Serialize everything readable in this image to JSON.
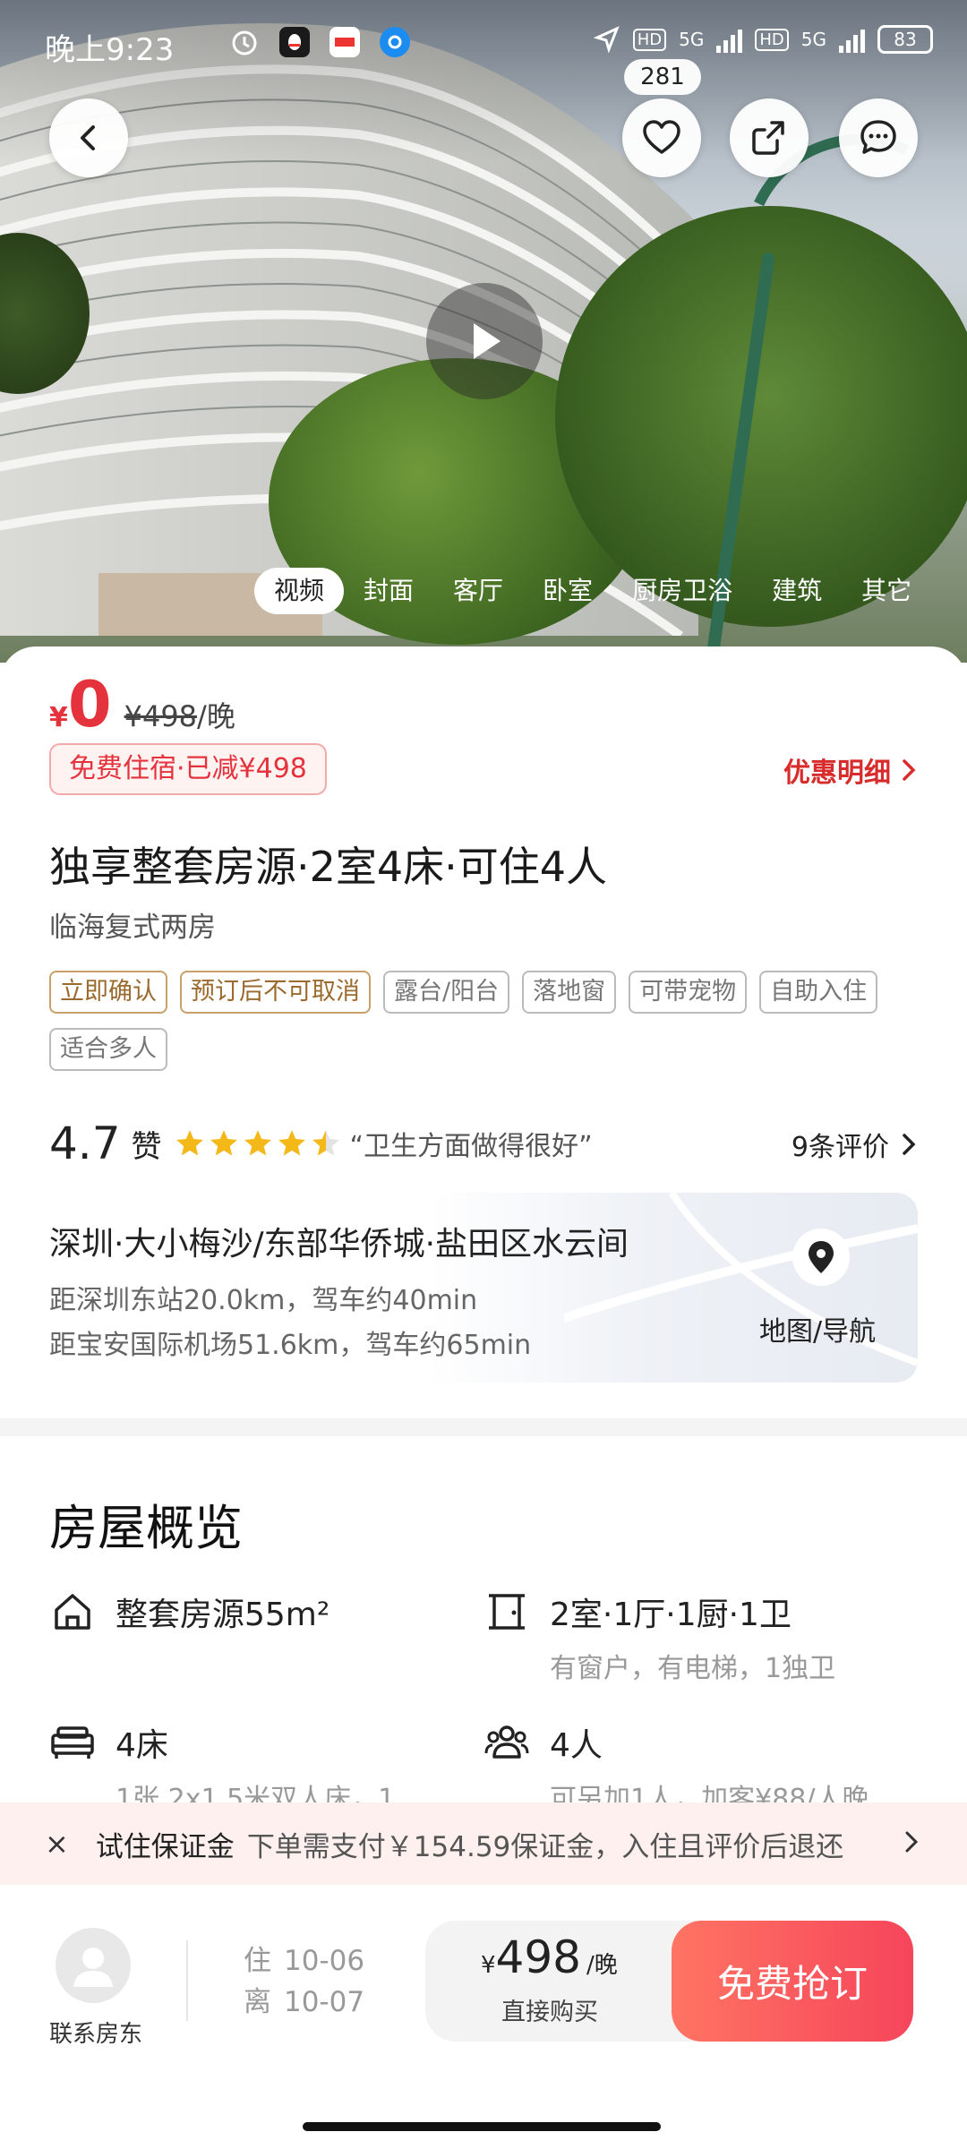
{
  "status_bar": {
    "time": "晚上9:23",
    "battery": "83",
    "network_1": "5G",
    "network_2": "5G",
    "hd_1": "HD",
    "hd_2": "HD"
  },
  "hero": {
    "favorite_count": "281",
    "photo_tabs": [
      "视频",
      "封面",
      "客厅",
      "卧室",
      "厨房卫浴",
      "建筑",
      "其它"
    ],
    "active_tab": "视频"
  },
  "pricing": {
    "currency": "¥",
    "price": "0",
    "original": "¥498",
    "unit": "/晚",
    "badge": "免费住宿·已减¥498",
    "discount_detail": "优惠明细"
  },
  "listing": {
    "title": "独享整套房源·2室4床·可住4人",
    "subtitle": "临海复式两房",
    "tags": [
      {
        "label": "立即确认",
        "gold": true
      },
      {
        "label": "预订后不可取消",
        "gold": true
      },
      {
        "label": "露台/阳台",
        "gold": false
      },
      {
        "label": "落地窗",
        "gold": false
      },
      {
        "label": "可带宠物",
        "gold": false
      },
      {
        "label": "自助入住",
        "gold": false
      },
      {
        "label": "适合多人",
        "gold": false
      }
    ]
  },
  "rating": {
    "score": "4.7",
    "word": "赞",
    "stars": 4.5,
    "quote": "“卫生方面做得很好”",
    "reviews": "9条评价"
  },
  "location": {
    "title": "深圳·大小梅沙/东部华侨城·盐田区水云间",
    "line1": "距深圳东站20.0km，驾车约40min",
    "line2": "距宝安国际机场51.6km，驾车约65min",
    "map_label": "地图/导航"
  },
  "overview": {
    "title": "房屋概览",
    "features": [
      {
        "main": "整套房源55m²",
        "sub": ""
      },
      {
        "main": "2室·1厅·1厨·1卫",
        "sub": "有窗户，有电梯，1独卫"
      },
      {
        "main": "4床",
        "sub": "1张 2x1.5米双人床，1"
      },
      {
        "main": "4人",
        "sub": "可另加1人，加客¥88/人晚"
      }
    ]
  },
  "deposit": {
    "close": "×",
    "label": "试住保证金",
    "detail": "下单需支付￥154.59保证金，入住且评价后退还"
  },
  "bottom": {
    "contact": "联系房东",
    "checkin_key": "住",
    "checkin": "10-06",
    "checkout_key": "离",
    "checkout": "10-07",
    "buy_currency": "¥",
    "buy_price": "498",
    "buy_unit": "/晚",
    "buy_sub": "直接购买",
    "book_button": "免费抢订"
  },
  "colors": {
    "accent_red": "#e5333d",
    "book_gradient_start": "#ff7463",
    "book_gradient_end": "#f6455b",
    "star_gold": "#f5b819"
  }
}
